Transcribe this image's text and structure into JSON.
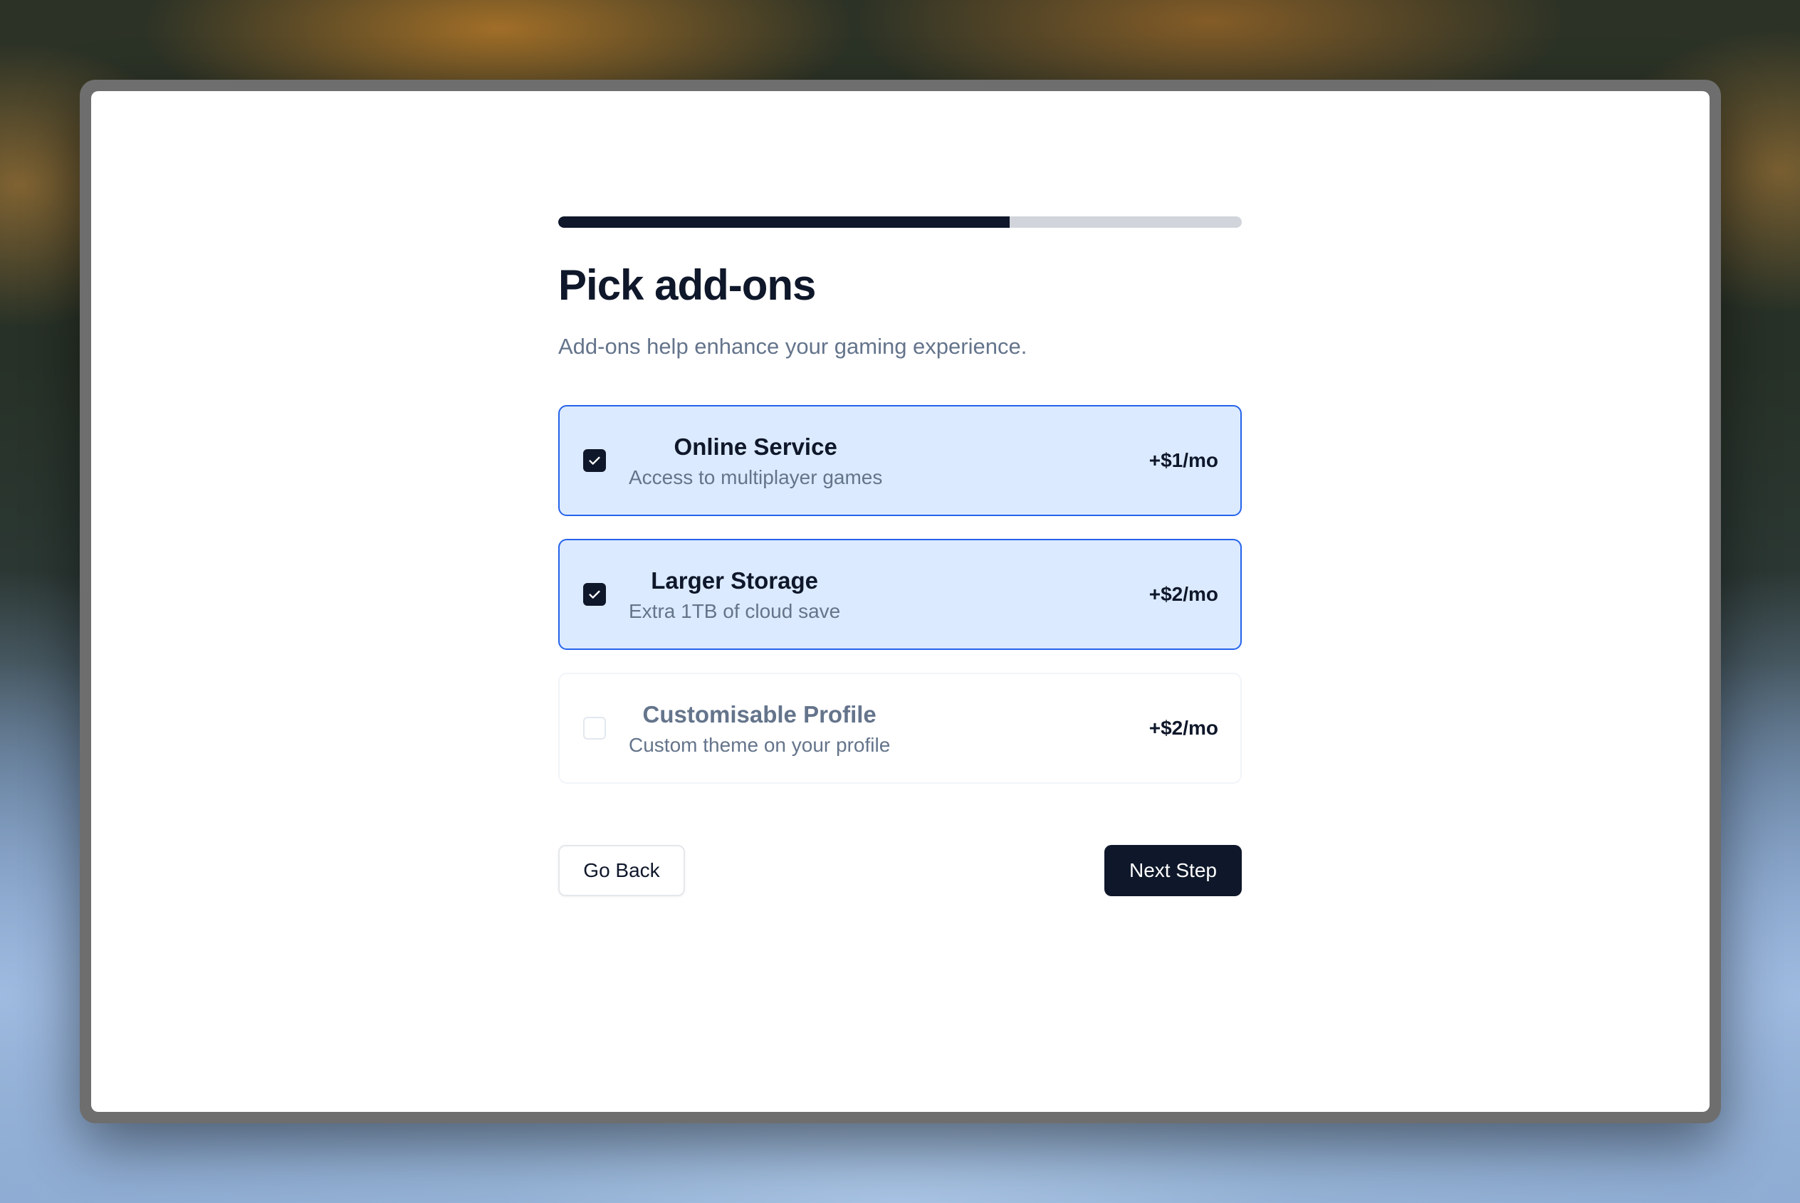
{
  "progress": {
    "value_fraction": 0.66
  },
  "header": {
    "title": "Pick add-ons",
    "subtitle": "Add-ons help enhance your gaming experience."
  },
  "addons": [
    {
      "name": "Online Service",
      "description": "Access to multiplayer games",
      "price": "+$1/mo",
      "checked": true
    },
    {
      "name": "Larger Storage",
      "description": "Extra 1TB of cloud save",
      "price": "+$2/mo",
      "checked": true
    },
    {
      "name": "Customisable Profile",
      "description": "Custom theme on your profile",
      "price": "+$2/mo",
      "checked": false
    }
  ],
  "actions": {
    "back_label": "Go Back",
    "next_label": "Next Step"
  },
  "colors": {
    "primary": "#0f172a",
    "accent_border": "#2563eb",
    "selected_bg": "#dbeafe",
    "muted_text": "#64748b",
    "progress_track": "#d1d5db"
  }
}
